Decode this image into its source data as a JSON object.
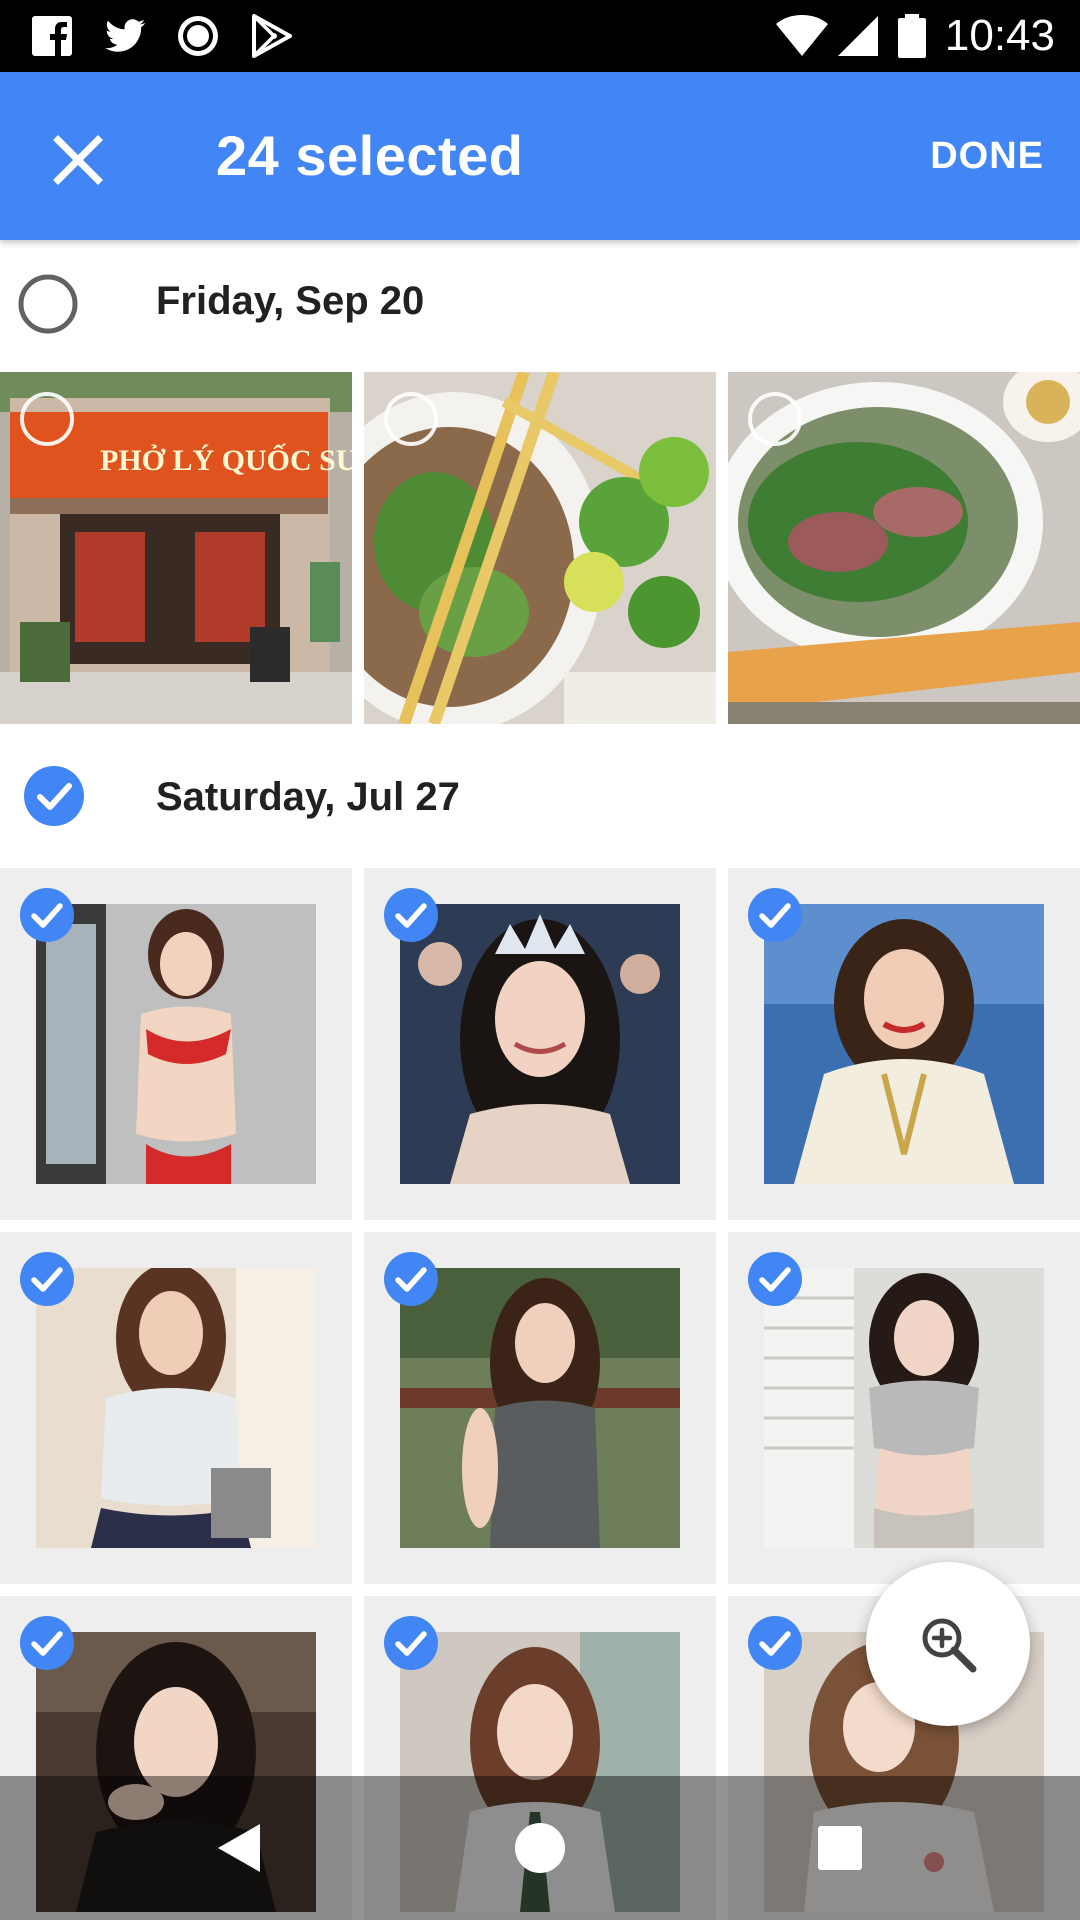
{
  "status_bar": {
    "time": "10:43",
    "left_icons": [
      "facebook-icon",
      "twitter-icon",
      "record-icon",
      "play-store-icon"
    ],
    "right_icons": [
      "wifi-icon",
      "signal-icon",
      "battery-icon"
    ]
  },
  "app_bar": {
    "title": "24 selected",
    "done_label": "DONE",
    "background": "#4285f4"
  },
  "sections": [
    {
      "date": "Friday, Sep 20",
      "all_selected": false,
      "photos": [
        {
          "subject": "pho-shop-storefront",
          "sign_text": "PHỞ LÝ QUỐC SU",
          "selected": false
        },
        {
          "subject": "pho-bowl-with-lime",
          "selected": false
        },
        {
          "subject": "pho-bowl-with-herbs",
          "selected": false
        }
      ]
    },
    {
      "date": "Saturday, Jul 27",
      "all_selected": true,
      "photos": [
        {
          "subject": "woman-red-swimsuit",
          "selected": true
        },
        {
          "subject": "woman-with-crown",
          "selected": true
        },
        {
          "subject": "woman-white-dress",
          "selected": true
        },
        {
          "subject": "woman-white-tshirt",
          "selected": true
        },
        {
          "subject": "woman-gray-tanktop",
          "selected": true
        },
        {
          "subject": "woman-gray-top",
          "selected": true
        },
        {
          "subject": "woman-dark-hair",
          "selected": true
        },
        {
          "subject": "woman-school-uniform",
          "selected": true
        },
        {
          "subject": "woman-white-shirt",
          "selected": true
        }
      ]
    }
  ],
  "fab": {
    "icon": "zoom-in-icon"
  },
  "nav_bar": {
    "icons": [
      "back-icon",
      "home-icon",
      "recents-icon"
    ]
  },
  "colors": {
    "accent": "#4285f4",
    "check_fill": "#4285f4",
    "unselected_ring": "#616161",
    "selected_tile_bg": "#eeeeee"
  }
}
